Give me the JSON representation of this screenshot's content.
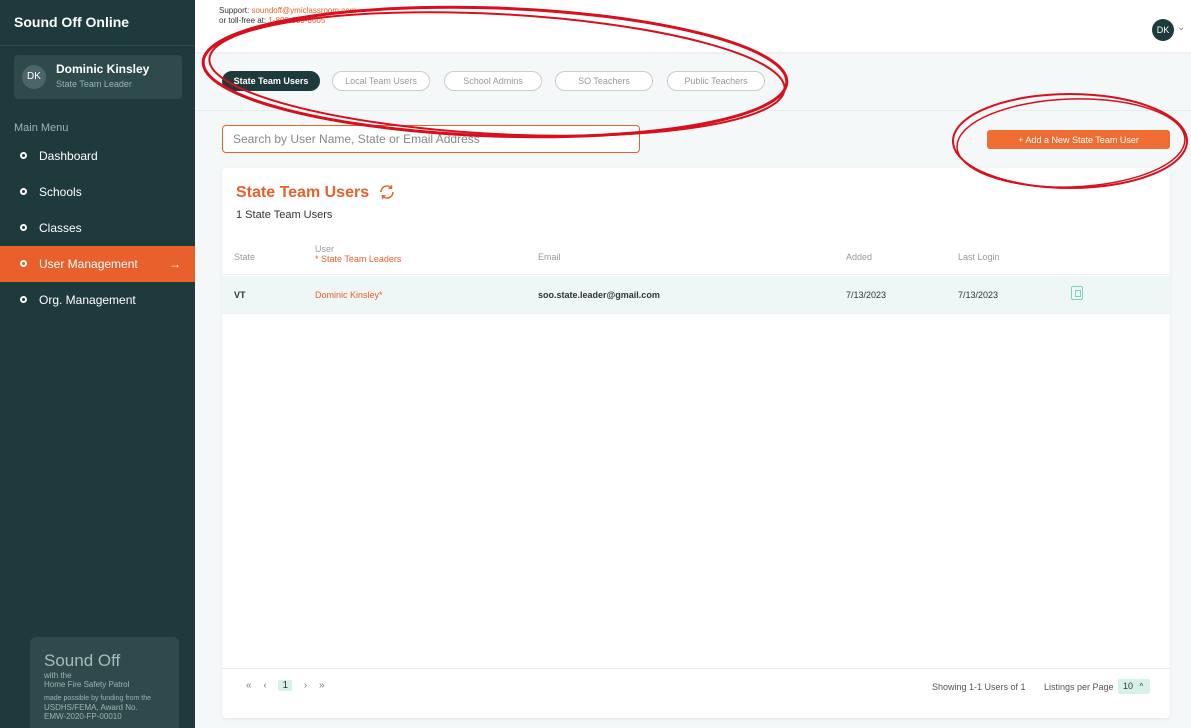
{
  "app": {
    "brand": "Sound Off Online"
  },
  "user": {
    "initials": "DK",
    "name": "Dominic Kinsley",
    "role": "State Team Leader"
  },
  "sidebar": {
    "menu_label": "Main Menu",
    "items": [
      {
        "label": "Dashboard"
      },
      {
        "label": "Schools"
      },
      {
        "label": "Classes"
      },
      {
        "label": "User Management",
        "arrow": "→"
      },
      {
        "label": "Org. Management"
      }
    ],
    "promo": {
      "title": "Sound Off",
      "sub1": "with the",
      "sub2": "Home Fire Safety Patrol",
      "note1": "made possible by funding from the",
      "note2": "USDHS/FEMA, Award No.",
      "note3": "EMW-2020-FP-00010"
    }
  },
  "topbar": {
    "support_label": "Support:",
    "support_email": "soundoff@ymiclassroom.com",
    "tollfree_label": "or toll-free at:",
    "tollfree_number": "1-800-859-8005",
    "avatar_initials": "DK",
    "chevron": "⌄"
  },
  "tabs": [
    {
      "label": "State Team Users",
      "active": true
    },
    {
      "label": "Local Team Users"
    },
    {
      "label": "School Admins"
    },
    {
      "label": "SO Teachers"
    },
    {
      "label": "Public Teachers"
    }
  ],
  "search": {
    "placeholder": "Search by User Name, State or Email Address",
    "value": ""
  },
  "add_button": {
    "label": "+ Add a New State Team User"
  },
  "panel": {
    "title": "State Team Users",
    "count": "1 State Team Users",
    "columns": {
      "state": "State",
      "user": "User",
      "user_note": "* State Team Leaders",
      "email": "Email",
      "added": "Added",
      "last_login": "Last Login"
    },
    "rows": [
      {
        "state": "VT",
        "user": "Dominic Kinsley*",
        "email": "soo.state.leader@gmail.com",
        "added": "7/13/2023",
        "last_login": "7/13/2023"
      }
    ],
    "pager": {
      "first": "«",
      "prev": "‹",
      "page": "1",
      "next": "›",
      "last": "»"
    },
    "showing": "Showing 1-1 Users of 1",
    "listings_label": "Listings per Page",
    "per_page": "10",
    "per_page_chevron": "^"
  },
  "colors": {
    "sidebar": "#1e3a3c",
    "accent": "#e8602c",
    "annotation": "#d6101e"
  }
}
